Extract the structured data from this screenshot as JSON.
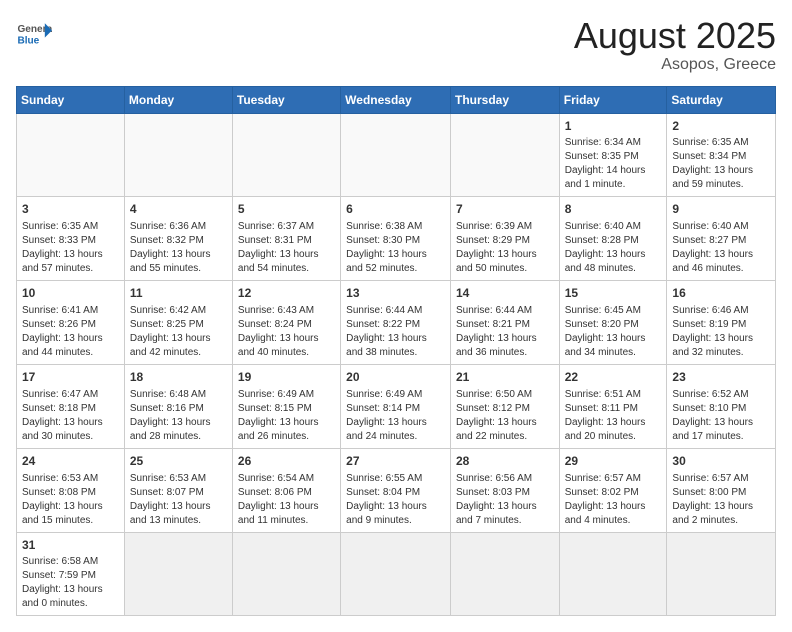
{
  "header": {
    "logo_general": "General",
    "logo_blue": "Blue",
    "title": "August 2025",
    "subtitle": "Asopos, Greece"
  },
  "weekdays": [
    "Sunday",
    "Monday",
    "Tuesday",
    "Wednesday",
    "Thursday",
    "Friday",
    "Saturday"
  ],
  "weeks": [
    [
      {
        "day": "",
        "info": ""
      },
      {
        "day": "",
        "info": ""
      },
      {
        "day": "",
        "info": ""
      },
      {
        "day": "",
        "info": ""
      },
      {
        "day": "",
        "info": ""
      },
      {
        "day": "1",
        "info": "Sunrise: 6:34 AM\nSunset: 8:35 PM\nDaylight: 14 hours and 1 minute."
      },
      {
        "day": "2",
        "info": "Sunrise: 6:35 AM\nSunset: 8:34 PM\nDaylight: 13 hours and 59 minutes."
      }
    ],
    [
      {
        "day": "3",
        "info": "Sunrise: 6:35 AM\nSunset: 8:33 PM\nDaylight: 13 hours and 57 minutes."
      },
      {
        "day": "4",
        "info": "Sunrise: 6:36 AM\nSunset: 8:32 PM\nDaylight: 13 hours and 55 minutes."
      },
      {
        "day": "5",
        "info": "Sunrise: 6:37 AM\nSunset: 8:31 PM\nDaylight: 13 hours and 54 minutes."
      },
      {
        "day": "6",
        "info": "Sunrise: 6:38 AM\nSunset: 8:30 PM\nDaylight: 13 hours and 52 minutes."
      },
      {
        "day": "7",
        "info": "Sunrise: 6:39 AM\nSunset: 8:29 PM\nDaylight: 13 hours and 50 minutes."
      },
      {
        "day": "8",
        "info": "Sunrise: 6:40 AM\nSunset: 8:28 PM\nDaylight: 13 hours and 48 minutes."
      },
      {
        "day": "9",
        "info": "Sunrise: 6:40 AM\nSunset: 8:27 PM\nDaylight: 13 hours and 46 minutes."
      }
    ],
    [
      {
        "day": "10",
        "info": "Sunrise: 6:41 AM\nSunset: 8:26 PM\nDaylight: 13 hours and 44 minutes."
      },
      {
        "day": "11",
        "info": "Sunrise: 6:42 AM\nSunset: 8:25 PM\nDaylight: 13 hours and 42 minutes."
      },
      {
        "day": "12",
        "info": "Sunrise: 6:43 AM\nSunset: 8:24 PM\nDaylight: 13 hours and 40 minutes."
      },
      {
        "day": "13",
        "info": "Sunrise: 6:44 AM\nSunset: 8:22 PM\nDaylight: 13 hours and 38 minutes."
      },
      {
        "day": "14",
        "info": "Sunrise: 6:44 AM\nSunset: 8:21 PM\nDaylight: 13 hours and 36 minutes."
      },
      {
        "day": "15",
        "info": "Sunrise: 6:45 AM\nSunset: 8:20 PM\nDaylight: 13 hours and 34 minutes."
      },
      {
        "day": "16",
        "info": "Sunrise: 6:46 AM\nSunset: 8:19 PM\nDaylight: 13 hours and 32 minutes."
      }
    ],
    [
      {
        "day": "17",
        "info": "Sunrise: 6:47 AM\nSunset: 8:18 PM\nDaylight: 13 hours and 30 minutes."
      },
      {
        "day": "18",
        "info": "Sunrise: 6:48 AM\nSunset: 8:16 PM\nDaylight: 13 hours and 28 minutes."
      },
      {
        "day": "19",
        "info": "Sunrise: 6:49 AM\nSunset: 8:15 PM\nDaylight: 13 hours and 26 minutes."
      },
      {
        "day": "20",
        "info": "Sunrise: 6:49 AM\nSunset: 8:14 PM\nDaylight: 13 hours and 24 minutes."
      },
      {
        "day": "21",
        "info": "Sunrise: 6:50 AM\nSunset: 8:12 PM\nDaylight: 13 hours and 22 minutes."
      },
      {
        "day": "22",
        "info": "Sunrise: 6:51 AM\nSunset: 8:11 PM\nDaylight: 13 hours and 20 minutes."
      },
      {
        "day": "23",
        "info": "Sunrise: 6:52 AM\nSunset: 8:10 PM\nDaylight: 13 hours and 17 minutes."
      }
    ],
    [
      {
        "day": "24",
        "info": "Sunrise: 6:53 AM\nSunset: 8:08 PM\nDaylight: 13 hours and 15 minutes."
      },
      {
        "day": "25",
        "info": "Sunrise: 6:53 AM\nSunset: 8:07 PM\nDaylight: 13 hours and 13 minutes."
      },
      {
        "day": "26",
        "info": "Sunrise: 6:54 AM\nSunset: 8:06 PM\nDaylight: 13 hours and 11 minutes."
      },
      {
        "day": "27",
        "info": "Sunrise: 6:55 AM\nSunset: 8:04 PM\nDaylight: 13 hours and 9 minutes."
      },
      {
        "day": "28",
        "info": "Sunrise: 6:56 AM\nSunset: 8:03 PM\nDaylight: 13 hours and 7 minutes."
      },
      {
        "day": "29",
        "info": "Sunrise: 6:57 AM\nSunset: 8:02 PM\nDaylight: 13 hours and 4 minutes."
      },
      {
        "day": "30",
        "info": "Sunrise: 6:57 AM\nSunset: 8:00 PM\nDaylight: 13 hours and 2 minutes."
      }
    ],
    [
      {
        "day": "31",
        "info": "Sunrise: 6:58 AM\nSunset: 7:59 PM\nDaylight: 13 hours and 0 minutes."
      },
      {
        "day": "",
        "info": ""
      },
      {
        "day": "",
        "info": ""
      },
      {
        "day": "",
        "info": ""
      },
      {
        "day": "",
        "info": ""
      },
      {
        "day": "",
        "info": ""
      },
      {
        "day": "",
        "info": ""
      }
    ]
  ]
}
